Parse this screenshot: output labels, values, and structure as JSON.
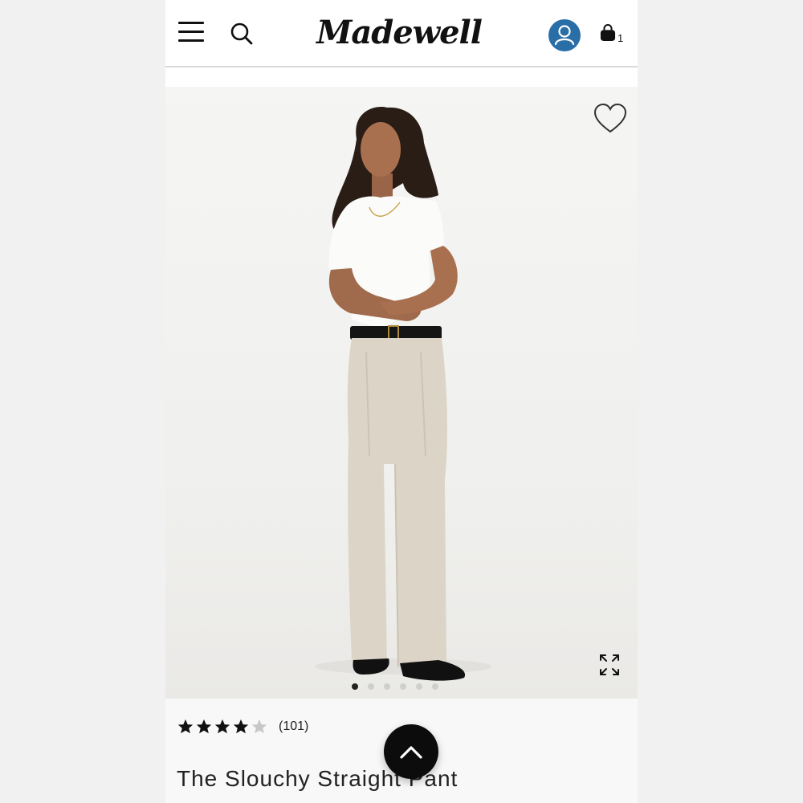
{
  "brand": {
    "logo_text": "Madewell"
  },
  "header": {
    "menu_icon": "hamburger-menu-icon",
    "search_icon": "search-icon",
    "account_icon": "user-account-icon",
    "bag_icon": "shopping-bag-icon",
    "bag_count": "1",
    "account_color": "#2a6ea8"
  },
  "gallery": {
    "image_description_icon": "product-photo",
    "wishlist_icon": "heart-outline-icon",
    "expand_icon": "expand-arrows-icon",
    "slide_count": 6,
    "active_slide": 1
  },
  "product": {
    "rating": 4,
    "rating_max": 5,
    "review_count": "(101)",
    "title": "The Slouchy Straight Pant"
  },
  "back_to_top": {
    "icon": "chevron-up-icon"
  }
}
